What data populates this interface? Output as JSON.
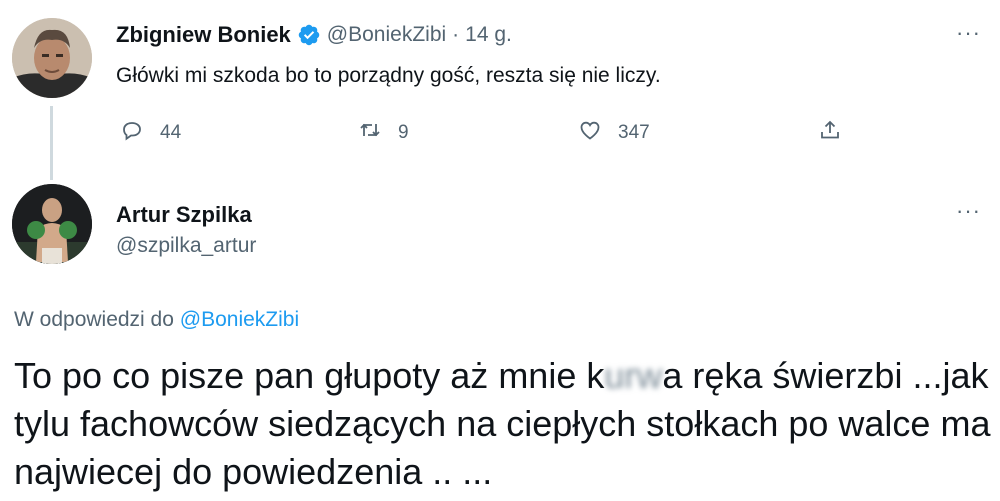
{
  "tweet1": {
    "display_name": "Zbigniew Boniek",
    "handle": "@BoniekZibi",
    "separator": "·",
    "time": "14 g.",
    "text": "Główki mi szkoda bo to porządny gość, reszta się nie liczy.",
    "more_label": "···",
    "replies": "44",
    "retweets": "9",
    "likes": "347",
    "verified_icon": "verified-badge-icon",
    "accent_color": "#1d9bf0"
  },
  "tweet2": {
    "display_name": "Artur Szpilka",
    "handle": "@szpilka_artur",
    "more_label": "···",
    "reply_prefix": "W odpowiedzi do",
    "reply_mention": "@BoniekZibi",
    "text_part1": "To po co pisze pan głupoty aż mnie k",
    "text_blurred": "urw",
    "text_part2": "a ręka świerzbi ...jak tylu fachowców siedzących na ciepłych stołkach po walce ma najwiecej do powiedzenia .. ..."
  }
}
